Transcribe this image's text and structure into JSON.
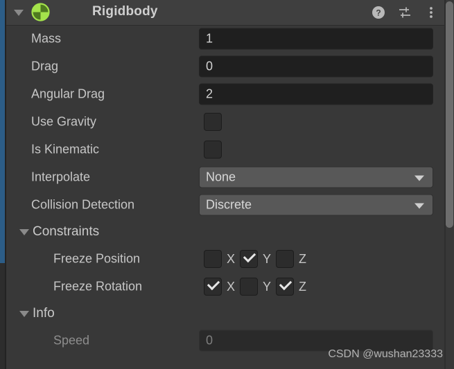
{
  "component": {
    "title": "Rigidbody",
    "icon": "rigidbody-icon",
    "expanded": true,
    "header_buttons": [
      {
        "name": "help-icon",
        "label": "?"
      },
      {
        "name": "preset-icon",
        "label": ""
      },
      {
        "name": "more-menu-icon",
        "label": ""
      }
    ]
  },
  "properties": {
    "mass": {
      "label": "Mass",
      "value": "1"
    },
    "drag": {
      "label": "Drag",
      "value": "0"
    },
    "angular_drag": {
      "label": "Angular Drag",
      "value": "2"
    },
    "use_gravity": {
      "label": "Use Gravity",
      "checked": false
    },
    "is_kinematic": {
      "label": "Is Kinematic",
      "checked": false
    },
    "interpolate": {
      "label": "Interpolate",
      "value": "None"
    },
    "collision_detection": {
      "label": "Collision Detection",
      "value": "Discrete"
    }
  },
  "constraints": {
    "title": "Constraints",
    "expanded": true,
    "freeze_position": {
      "label": "Freeze Position",
      "axes": [
        {
          "name": "X",
          "checked": false
        },
        {
          "name": "Y",
          "checked": true
        },
        {
          "name": "Z",
          "checked": false
        }
      ]
    },
    "freeze_rotation": {
      "label": "Freeze Rotation",
      "axes": [
        {
          "name": "X",
          "checked": true
        },
        {
          "name": "Y",
          "checked": false
        },
        {
          "name": "Z",
          "checked": true
        }
      ]
    }
  },
  "info": {
    "title": "Info",
    "expanded": true,
    "speed": {
      "label": "Speed",
      "value": "0"
    }
  },
  "watermark": "CSDN @wushan23333",
  "colors": {
    "panel_bg": "#383838",
    "header_bg": "#3f3f3f",
    "field_bg": "#1f1f1f",
    "dropdown_bg": "#585858",
    "text": "#c6c6c6",
    "accent_green": "#a4e34b",
    "selection_blue": "#2c5d87"
  }
}
